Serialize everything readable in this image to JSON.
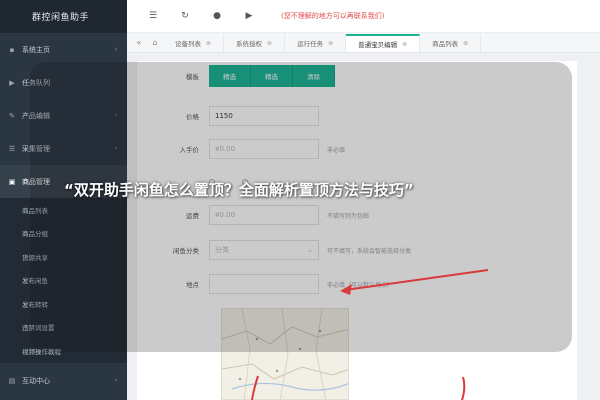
{
  "sidebar": {
    "brand": "群控闲鱼助手",
    "items": [
      {
        "icon": "home-icon",
        "glyph": "▪",
        "label": "系统主页",
        "arrow": "‹"
      },
      {
        "icon": "play-icon",
        "glyph": "▶",
        "label": "任务队列",
        "arrow": ""
      },
      {
        "icon": "edit-icon",
        "glyph": "✎",
        "label": "产品编辑",
        "arrow": "‹"
      },
      {
        "icon": "collect-icon",
        "glyph": "☰",
        "label": "采集管理",
        "arrow": "‹"
      },
      {
        "icon": "goods-icon",
        "glyph": "▣",
        "label": "商品管理",
        "arrow": "⌄"
      }
    ],
    "sub_items": [
      "商品列表",
      "商品分组",
      "货源共享",
      "发布闲鱼",
      "发布转转",
      "违禁词设置",
      "视频操作教程"
    ],
    "bottom": {
      "icon": "interact-icon",
      "glyph": "▤",
      "label": "互动中心",
      "arrow": "‹"
    }
  },
  "toolbar": {
    "menu_glyph": "☰",
    "refresh_glyph": "↻",
    "shop_glyph": "●",
    "play_glyph": "▶",
    "notice": "(您不理解的地方可以再联系我们)"
  },
  "tabs": {
    "back_glyph": "«",
    "home_glyph": "⌂",
    "items": [
      {
        "label": "设备列表"
      },
      {
        "label": "系统授权"
      },
      {
        "label": "运行任务"
      },
      {
        "label": "普通宝贝编辑"
      },
      {
        "label": "商品列表"
      }
    ]
  },
  "form": {
    "mode_label": "模板",
    "mode_buttons": [
      "精选",
      "精选",
      "清除"
    ],
    "price_label": "价格",
    "price_value": "1150",
    "cost_label": "入手价",
    "cost_placeholder": "¥0.00",
    "cost_hint": "非必填",
    "shipping_label": "运费",
    "shipping_placeholder": "¥0.00",
    "shipping_hint": "不填写则为包邮",
    "category_label": "闲鱼分类",
    "category_value": "分类",
    "category_hint": "可不填写，系统会智能选择分类",
    "location_label": "地点",
    "location_hint": "非必填（可以默认地点）"
  },
  "overlay": {
    "title": "“双开助手闲鱼怎么置顶？全面解析置顶方法与技巧”"
  },
  "colors": {
    "sidebar_bg": "#2b3643",
    "accent": "#1ab394",
    "notice": "#e24b4b",
    "annotation": "#d93a3a"
  }
}
